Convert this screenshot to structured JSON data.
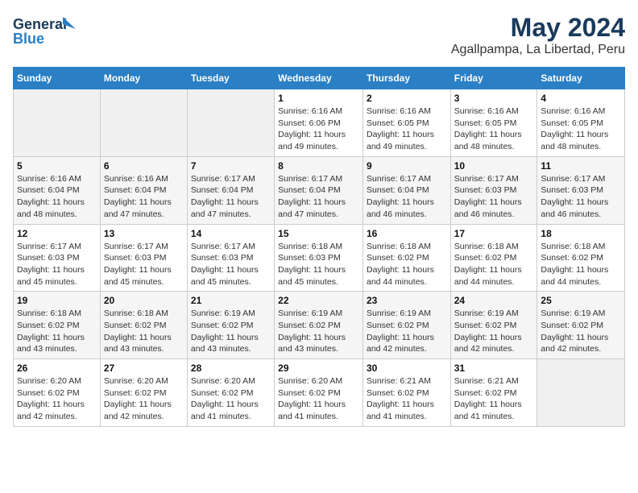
{
  "header": {
    "logo_text_general": "General",
    "logo_text_blue": "Blue",
    "month": "May 2024",
    "location": "Agallpampa, La Libertad, Peru"
  },
  "weekdays": [
    "Sunday",
    "Monday",
    "Tuesday",
    "Wednesday",
    "Thursday",
    "Friday",
    "Saturday"
  ],
  "weeks": [
    [
      {
        "day": "",
        "info": ""
      },
      {
        "day": "",
        "info": ""
      },
      {
        "day": "",
        "info": ""
      },
      {
        "day": "1",
        "info": "Sunrise: 6:16 AM\nSunset: 6:06 PM\nDaylight: 11 hours\nand 49 minutes."
      },
      {
        "day": "2",
        "info": "Sunrise: 6:16 AM\nSunset: 6:05 PM\nDaylight: 11 hours\nand 49 minutes."
      },
      {
        "day": "3",
        "info": "Sunrise: 6:16 AM\nSunset: 6:05 PM\nDaylight: 11 hours\nand 48 minutes."
      },
      {
        "day": "4",
        "info": "Sunrise: 6:16 AM\nSunset: 6:05 PM\nDaylight: 11 hours\nand 48 minutes."
      }
    ],
    [
      {
        "day": "5",
        "info": "Sunrise: 6:16 AM\nSunset: 6:04 PM\nDaylight: 11 hours\nand 48 minutes."
      },
      {
        "day": "6",
        "info": "Sunrise: 6:16 AM\nSunset: 6:04 PM\nDaylight: 11 hours\nand 47 minutes."
      },
      {
        "day": "7",
        "info": "Sunrise: 6:17 AM\nSunset: 6:04 PM\nDaylight: 11 hours\nand 47 minutes."
      },
      {
        "day": "8",
        "info": "Sunrise: 6:17 AM\nSunset: 6:04 PM\nDaylight: 11 hours\nand 47 minutes."
      },
      {
        "day": "9",
        "info": "Sunrise: 6:17 AM\nSunset: 6:04 PM\nDaylight: 11 hours\nand 46 minutes."
      },
      {
        "day": "10",
        "info": "Sunrise: 6:17 AM\nSunset: 6:03 PM\nDaylight: 11 hours\nand 46 minutes."
      },
      {
        "day": "11",
        "info": "Sunrise: 6:17 AM\nSunset: 6:03 PM\nDaylight: 11 hours\nand 46 minutes."
      }
    ],
    [
      {
        "day": "12",
        "info": "Sunrise: 6:17 AM\nSunset: 6:03 PM\nDaylight: 11 hours\nand 45 minutes."
      },
      {
        "day": "13",
        "info": "Sunrise: 6:17 AM\nSunset: 6:03 PM\nDaylight: 11 hours\nand 45 minutes."
      },
      {
        "day": "14",
        "info": "Sunrise: 6:17 AM\nSunset: 6:03 PM\nDaylight: 11 hours\nand 45 minutes."
      },
      {
        "day": "15",
        "info": "Sunrise: 6:18 AM\nSunset: 6:03 PM\nDaylight: 11 hours\nand 45 minutes."
      },
      {
        "day": "16",
        "info": "Sunrise: 6:18 AM\nSunset: 6:02 PM\nDaylight: 11 hours\nand 44 minutes."
      },
      {
        "day": "17",
        "info": "Sunrise: 6:18 AM\nSunset: 6:02 PM\nDaylight: 11 hours\nand 44 minutes."
      },
      {
        "day": "18",
        "info": "Sunrise: 6:18 AM\nSunset: 6:02 PM\nDaylight: 11 hours\nand 44 minutes."
      }
    ],
    [
      {
        "day": "19",
        "info": "Sunrise: 6:18 AM\nSunset: 6:02 PM\nDaylight: 11 hours\nand 43 minutes."
      },
      {
        "day": "20",
        "info": "Sunrise: 6:18 AM\nSunset: 6:02 PM\nDaylight: 11 hours\nand 43 minutes."
      },
      {
        "day": "21",
        "info": "Sunrise: 6:19 AM\nSunset: 6:02 PM\nDaylight: 11 hours\nand 43 minutes."
      },
      {
        "day": "22",
        "info": "Sunrise: 6:19 AM\nSunset: 6:02 PM\nDaylight: 11 hours\nand 43 minutes."
      },
      {
        "day": "23",
        "info": "Sunrise: 6:19 AM\nSunset: 6:02 PM\nDaylight: 11 hours\nand 42 minutes."
      },
      {
        "day": "24",
        "info": "Sunrise: 6:19 AM\nSunset: 6:02 PM\nDaylight: 11 hours\nand 42 minutes."
      },
      {
        "day": "25",
        "info": "Sunrise: 6:19 AM\nSunset: 6:02 PM\nDaylight: 11 hours\nand 42 minutes."
      }
    ],
    [
      {
        "day": "26",
        "info": "Sunrise: 6:20 AM\nSunset: 6:02 PM\nDaylight: 11 hours\nand 42 minutes."
      },
      {
        "day": "27",
        "info": "Sunrise: 6:20 AM\nSunset: 6:02 PM\nDaylight: 11 hours\nand 42 minutes."
      },
      {
        "day": "28",
        "info": "Sunrise: 6:20 AM\nSunset: 6:02 PM\nDaylight: 11 hours\nand 41 minutes."
      },
      {
        "day": "29",
        "info": "Sunrise: 6:20 AM\nSunset: 6:02 PM\nDaylight: 11 hours\nand 41 minutes."
      },
      {
        "day": "30",
        "info": "Sunrise: 6:21 AM\nSunset: 6:02 PM\nDaylight: 11 hours\nand 41 minutes."
      },
      {
        "day": "31",
        "info": "Sunrise: 6:21 AM\nSunset: 6:02 PM\nDaylight: 11 hours\nand 41 minutes."
      },
      {
        "day": "",
        "info": ""
      }
    ]
  ]
}
